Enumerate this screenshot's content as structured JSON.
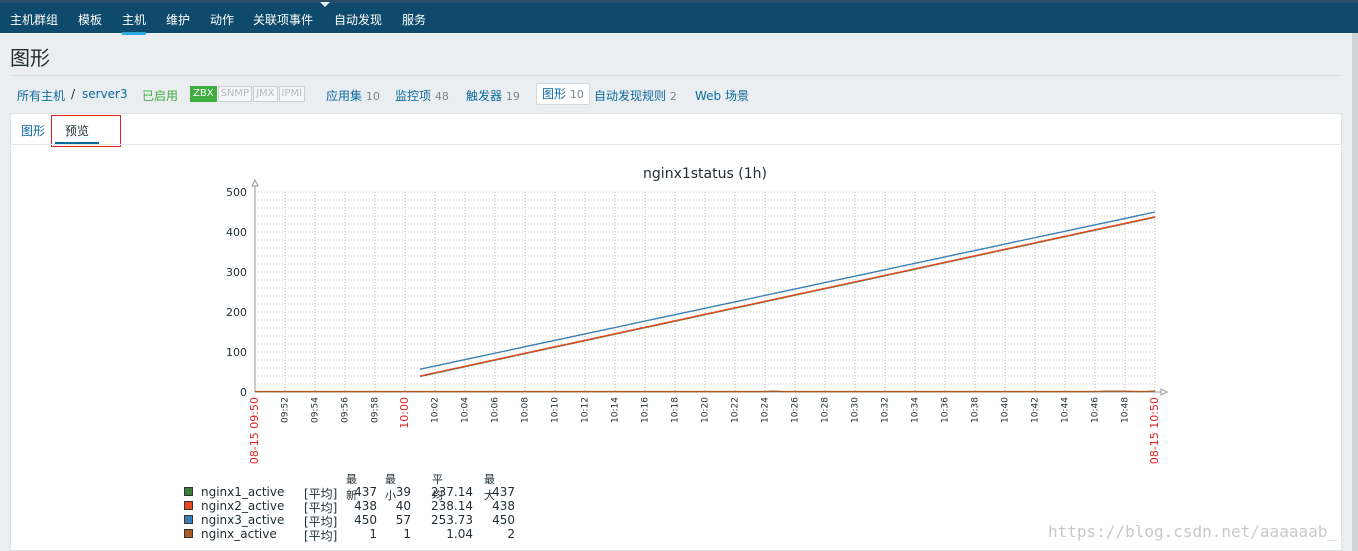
{
  "top_nav": {
    "items": [
      "主机群组",
      "模板",
      "主机",
      "维护",
      "动作",
      "关联项事件",
      "自动发现",
      "服务"
    ],
    "active": "主机"
  },
  "page_title": "图形",
  "breadcrumb": {
    "all_hosts": "所有主机",
    "separator": "/",
    "host": "server3",
    "status": "已启用",
    "badges": [
      "ZBX",
      "SNMP",
      "JMX",
      "IPMI"
    ],
    "tabs": [
      {
        "label": "应用集",
        "count": "10"
      },
      {
        "label": "监控项",
        "count": "48"
      },
      {
        "label": "触发器",
        "count": "19"
      },
      {
        "label": "图形",
        "count": "10"
      },
      {
        "label": "自动发现规则",
        "count": "2"
      },
      {
        "label": "Web 场景",
        "count": ""
      }
    ]
  },
  "panel_tabs": {
    "graph": "图形",
    "preview": "预览"
  },
  "chart_data": {
    "type": "line",
    "title": "nginx1status (1h)",
    "ylim": [
      0,
      500
    ],
    "yticks": [
      "0",
      "100",
      "200",
      "300",
      "400",
      "500"
    ],
    "x_start_label": "08-15 09:50",
    "x_end_label": "08-15 10:50",
    "x_tick_labels": [
      "09:52",
      "09:54",
      "09:56",
      "09:58",
      "10:00",
      "10:02",
      "10:04",
      "10:06",
      "10:08",
      "10:10",
      "10:12",
      "10:14",
      "10:16",
      "10:18",
      "10:20",
      "10:22",
      "10:24",
      "10:26",
      "10:28",
      "10:30",
      "10:32",
      "10:34",
      "10:36",
      "10:38",
      "10:40",
      "10:42",
      "10:44",
      "10:46",
      "10:48",
      "10:50"
    ],
    "grid": true,
    "series": [
      {
        "name": "nginx1_active",
        "color": "#3c7a3c",
        "x": [
          11,
          60
        ],
        "y": [
          39,
          437
        ]
      },
      {
        "name": "nginx2_active",
        "color": "#e8481f",
        "x": [
          11,
          60
        ],
        "y": [
          40,
          438
        ]
      },
      {
        "name": "nginx3_active",
        "color": "#3b7fb6",
        "x": [
          11,
          60
        ],
        "y": [
          57,
          450
        ]
      },
      {
        "name": "nginx_active",
        "color": "#a85a21",
        "x": [
          0,
          34,
          34.6,
          35.2,
          56,
          56.8,
          57.8,
          59,
          60
        ],
        "y": [
          1,
          1,
          2,
          1,
          1,
          2,
          2,
          1,
          2
        ]
      }
    ]
  },
  "legend": {
    "headers": [
      "最新",
      "最小",
      "平均",
      "最大"
    ],
    "func": "[平均]",
    "rows": [
      {
        "name": "nginx1_active",
        "color": "#3c7a3c",
        "last": "437",
        "min": "39",
        "avg": "237.14",
        "max": "437"
      },
      {
        "name": "nginx2_active",
        "color": "#e8481f",
        "last": "438",
        "min": "40",
        "avg": "238.14",
        "max": "438"
      },
      {
        "name": "nginx3_active",
        "color": "#3b7fb6",
        "last": "450",
        "min": "57",
        "avg": "253.73",
        "max": "450"
      },
      {
        "name": "nginx_active",
        "color": "#a85a21",
        "last": "1",
        "min": "1",
        "avg": "1.04",
        "max": "2"
      }
    ]
  },
  "watermark": "https://blog.csdn.net/aaaaaab_"
}
